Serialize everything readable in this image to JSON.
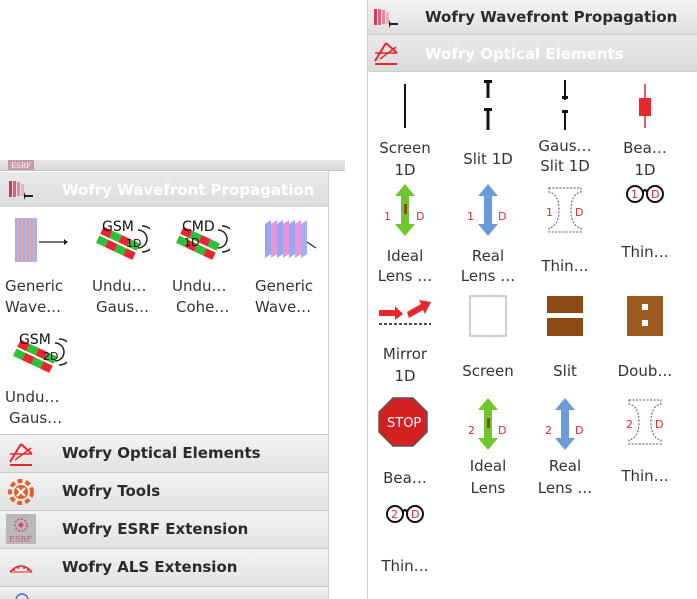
{
  "left": {
    "active_category": "Wofry Wavefront Propagation",
    "widgets": [
      {
        "name": "generic-wavefront-widget",
        "l1": "Generic",
        "l2": "Wave…"
      },
      {
        "name": "undulator-gaussian-widget",
        "l1": "Undu…",
        "l2": "Gaus…"
      },
      {
        "name": "undulator-coherent-widget",
        "l1": "Undu…",
        "l2": "Cohe…"
      },
      {
        "name": "generic-wavefront-2-widget",
        "l1": "Generic",
        "l2": "Wave…"
      },
      {
        "name": "undulator-gaussian-2d-widget",
        "l1": "Undu…",
        "l2": "Gaus…"
      }
    ],
    "icon_texts": {
      "gsm": "GSM",
      "cmd": "CMD",
      "d1": "1D",
      "d2": "2D"
    },
    "categories": [
      {
        "label": "Wofry Optical Elements"
      },
      {
        "label": "Wofry Tools"
      },
      {
        "label": "Wofry ESRF Extension"
      },
      {
        "label": "Wofry ALS Extension"
      }
    ],
    "esrf_logo_text": "ESRF"
  },
  "right": {
    "header_propagation": "Wofry Wavefront Propagation",
    "header_optical": "Wofry Optical Elements",
    "items": [
      {
        "l1": "Screen",
        "l2": "1D"
      },
      {
        "l1": "Slit 1D",
        "l2": ""
      },
      {
        "l1": "Gaus…",
        "l2": "Slit 1D"
      },
      {
        "l1": "Bea…",
        "l2": "1D"
      },
      {
        "l1": "Ideal",
        "l2": "Lens …"
      },
      {
        "l1": "Real",
        "l2": "Lens …"
      },
      {
        "l1": "Thin…",
        "l2": ""
      },
      {
        "l1": "Thin…",
        "l2": ""
      },
      {
        "l1": "Mirror",
        "l2": "1D"
      },
      {
        "l1": "Screen",
        "l2": ""
      },
      {
        "l1": "Slit",
        "l2": ""
      },
      {
        "l1": "Doub…",
        "l2": ""
      },
      {
        "l1": "Bea…",
        "l2": ""
      },
      {
        "l1": "Ideal",
        "l2": "Lens"
      },
      {
        "l1": "Real",
        "l2": "Lens …"
      },
      {
        "l1": "Thin…",
        "l2": ""
      },
      {
        "l1": "Thin…",
        "l2": ""
      }
    ],
    "icon_texts": {
      "one": "1",
      "two": "2",
      "d": "D",
      "stop": "STOP"
    }
  },
  "colors": {
    "active_header_text": "#ffffff",
    "header_text": "#2b2b2b",
    "green_arrow": "#6cc72e",
    "blue_arrow": "#6a9bd8",
    "red": "#e8262d",
    "brown": "#8b4a14",
    "stop_red": "#d42020"
  }
}
